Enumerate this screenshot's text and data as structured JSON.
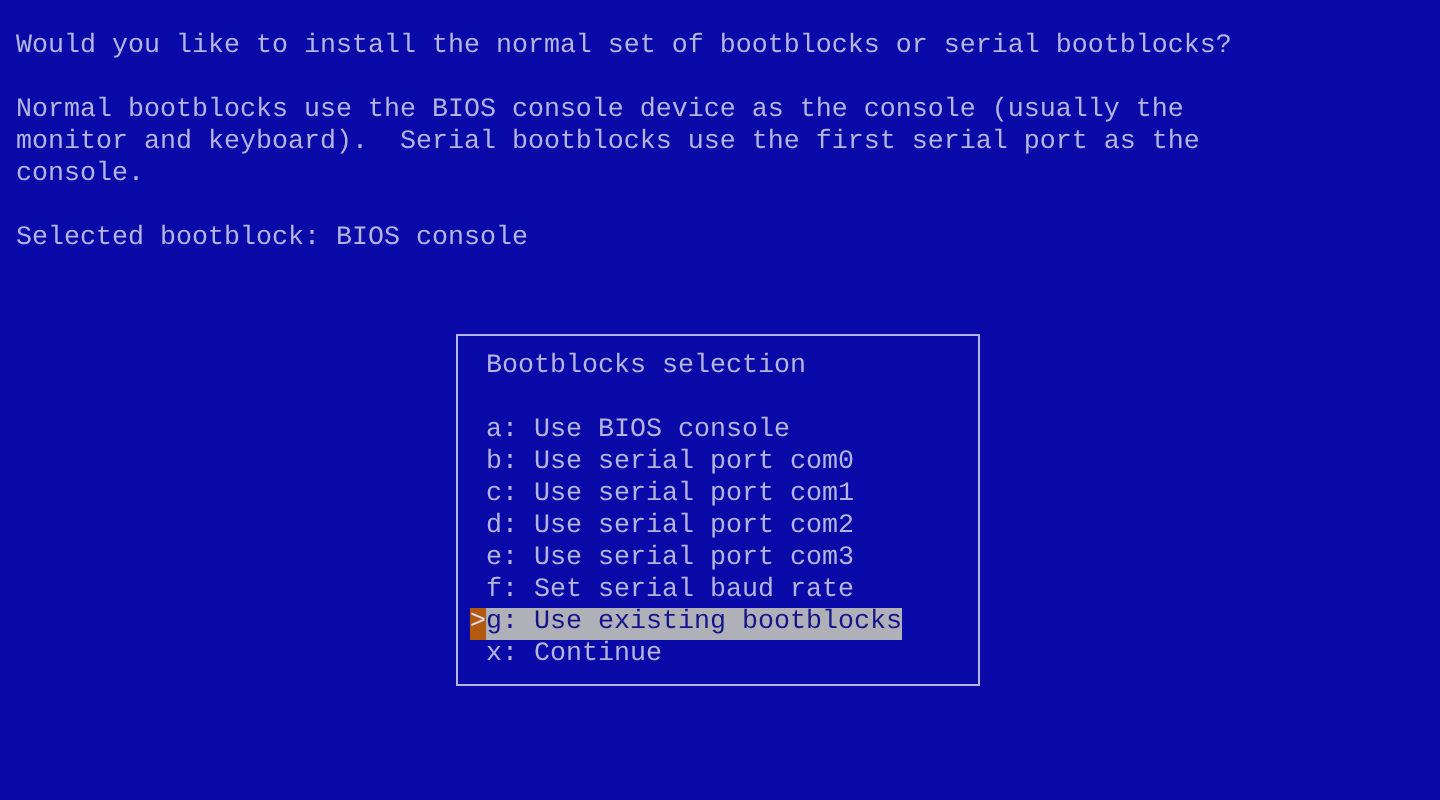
{
  "question": "Would you like to install the normal set of bootblocks or serial bootblocks?",
  "description_lines": [
    "Normal bootblocks use the BIOS console device as the console (usually the",
    "monitor and keyboard).  Serial bootblocks use the first serial port as the",
    "console."
  ],
  "status": "Selected bootblock: BIOS console",
  "menu": {
    "title": "Bootblocks selection",
    "cursor": ">",
    "items": [
      {
        "text": "a: Use BIOS console",
        "selected": false
      },
      {
        "text": "b: Use serial port com0",
        "selected": false
      },
      {
        "text": "c: Use serial port com1",
        "selected": false
      },
      {
        "text": "d: Use serial port com2",
        "selected": false
      },
      {
        "text": "e: Use serial port com3",
        "selected": false
      },
      {
        "text": "f: Set serial baud rate",
        "selected": false
      },
      {
        "text": "g: Use existing bootblocks",
        "selected": true
      },
      {
        "text": "x: Continue",
        "selected": false
      }
    ]
  }
}
